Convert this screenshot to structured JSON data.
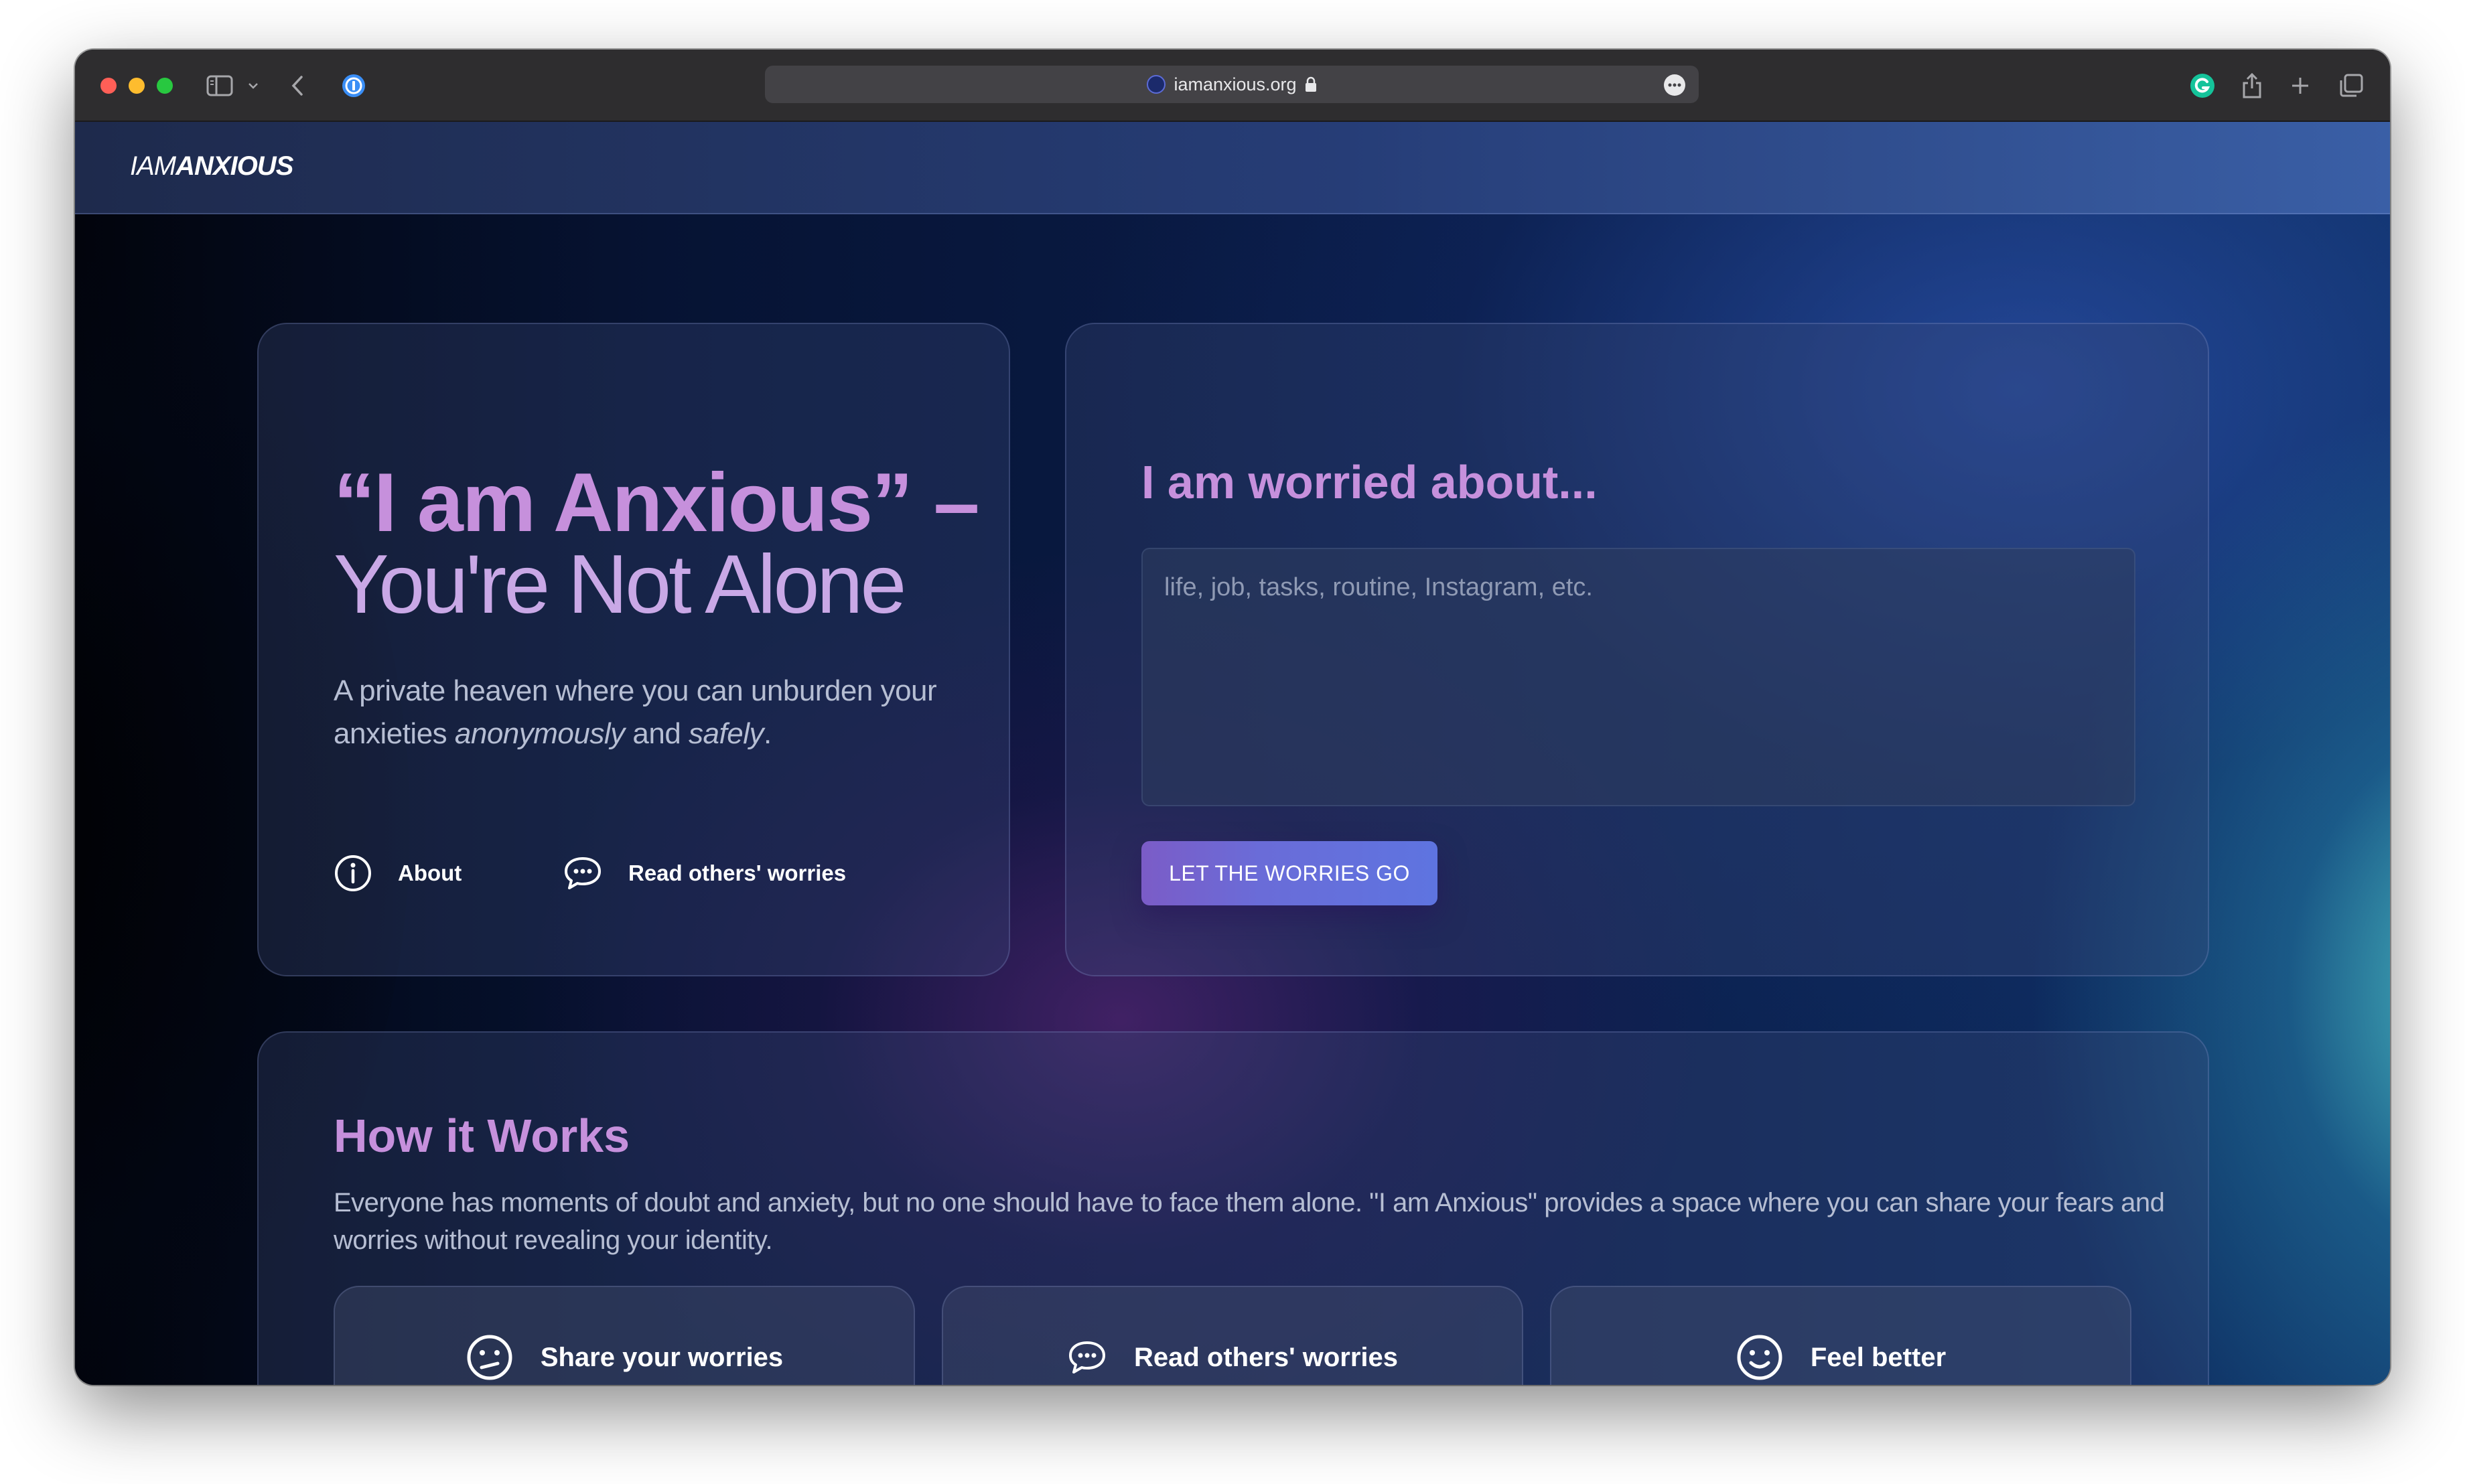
{
  "browser": {
    "url": "iamanxious.org"
  },
  "site": {
    "logo_light": "IAM",
    "logo_bold": "ANXIOUS"
  },
  "hero": {
    "title": "“I am Anxious” –",
    "subtitle": "You're Not Alone",
    "description_prefix": "A private heaven where you can unburden your anxieties ",
    "description_emphasis_1": "anonymously",
    "description_middle": " and ",
    "description_emphasis_2": "safely",
    "description_suffix": ".",
    "links": [
      {
        "label": "About",
        "icon": "info-icon"
      },
      {
        "label": "Read others' worries",
        "icon": "chat-bubble-icon"
      }
    ]
  },
  "worry_form": {
    "title": "I am worried about...",
    "placeholder": "life, job, tasks, routine, Instagram, etc.",
    "value": "",
    "submit_label": "LET THE WORRIES GO"
  },
  "how_it_works": {
    "title": "How it Works",
    "description": "Everyone has moments of doubt and anxiety, but no one should have to face them alone. \"I am Anxious\" provides a space where you can share your fears and worries without revealing your identity.",
    "steps": [
      {
        "label": "Share your worries",
        "icon": "confused-face-icon"
      },
      {
        "label": "Read others' worries",
        "icon": "chat-bubble-icon"
      },
      {
        "label": "Feel better",
        "icon": "smiling-face-icon"
      }
    ]
  },
  "colors": {
    "accent_purple": "#c690dc",
    "button_gradient_start": "#7b5cc7",
    "button_gradient_end": "#5e74e0"
  }
}
